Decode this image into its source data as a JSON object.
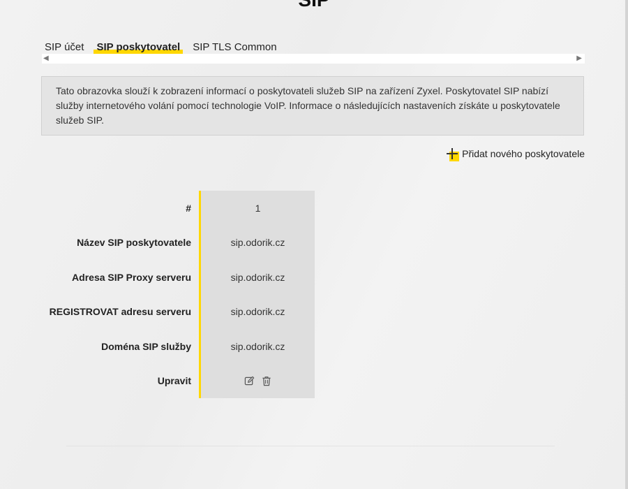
{
  "page": {
    "title": "SIP"
  },
  "tabs": [
    {
      "label": "SIP účet",
      "active": false
    },
    {
      "label": "SIP poskytovatel",
      "active": true
    },
    {
      "label": "SIP TLS Common",
      "active": false
    }
  ],
  "info_text": "Tato obrazovka slouží k zobrazení informací o poskytovateli služeb SIP na zařízení Zyxel. Poskytovatel SIP nabízí služby internetového volání pomocí technologie VoIP. Informace o následujících nastaveních získáte u poskytovatele služeb SIP.",
  "add_button": {
    "label": "Přidat nového poskytovatele",
    "icon": "plus-icon"
  },
  "table": {
    "rows": [
      {
        "label": "#",
        "value": "1"
      },
      {
        "label": "Název SIP poskytovatele",
        "value": "sip.odorik.cz"
      },
      {
        "label": "Adresa SIP Proxy serveru",
        "value": "sip.odorik.cz"
      },
      {
        "label": "REGISTROVAT adresu serveru",
        "value": "sip.odorik.cz"
      },
      {
        "label": "Doména SIP služby",
        "value": "sip.odorik.cz"
      },
      {
        "label": "Upravit",
        "value": ""
      }
    ],
    "actions": [
      {
        "icon": "edit-icon"
      },
      {
        "icon": "trash-icon"
      }
    ]
  },
  "colors": {
    "accent": "#ffd700",
    "panel": "#e4e4e4",
    "column": "#dedede"
  }
}
